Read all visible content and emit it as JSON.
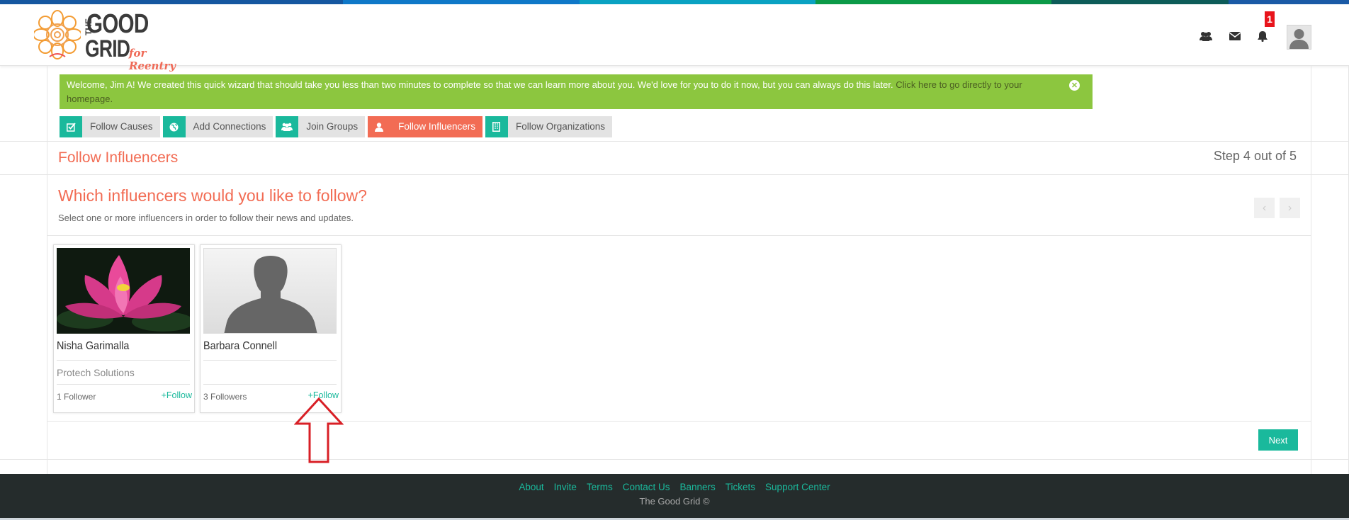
{
  "colorbar": [
    "#1557a0",
    "#0f6fc1",
    "#0aa0c0",
    "#0b9a48",
    "#0d5c59",
    "#1a5aa6"
  ],
  "logo": {
    "the": "THE",
    "good": "GOOD",
    "grid": "GRID",
    "tagline": "for Reentry"
  },
  "header": {
    "icons": [
      "people-icon",
      "envelope-icon",
      "bell-icon"
    ],
    "notification_count": "1"
  },
  "welcome": {
    "message": "Welcome, Jim A! We created this quick wizard that should take you less than two minutes to complete so that we can learn more about you. We'd love for you to do it now, but you can always do this later.",
    "link": "Click here to go directly to your homepage."
  },
  "tabs": [
    {
      "label": "Follow Causes",
      "icon": "checkbox-icon",
      "active": false
    },
    {
      "label": "Add Connections",
      "icon": "globe-icon",
      "active": false
    },
    {
      "label": "Join Groups",
      "icon": "group-icon",
      "active": false
    },
    {
      "label": "Follow Influencers",
      "icon": "user-icon",
      "active": true
    },
    {
      "label": "Follow Organizations",
      "icon": "building-icon",
      "active": false
    }
  ],
  "page": {
    "title": "Follow Influencers",
    "step": "Step 4 out of 5",
    "question": "Which influencers would you like to follow?",
    "subtitle": "Select one or more influencers in order to follow their news and updates."
  },
  "influencers": [
    {
      "name": "Nisha Garimalla",
      "organization": "Protech Solutions",
      "followers": "1 Follower",
      "follow_label": "+Follow",
      "image": "lotus-flower"
    },
    {
      "name": "Barbara Connell",
      "organization": "",
      "followers": "3 Followers",
      "follow_label": "+Follow",
      "image": "default-avatar"
    }
  ],
  "next_label": "Next",
  "footer": {
    "links": [
      "About",
      "Invite",
      "Terms",
      "Contact Us",
      "Banners",
      "Tickets",
      "Support Center"
    ],
    "copyright": "The Good Grid ©"
  }
}
